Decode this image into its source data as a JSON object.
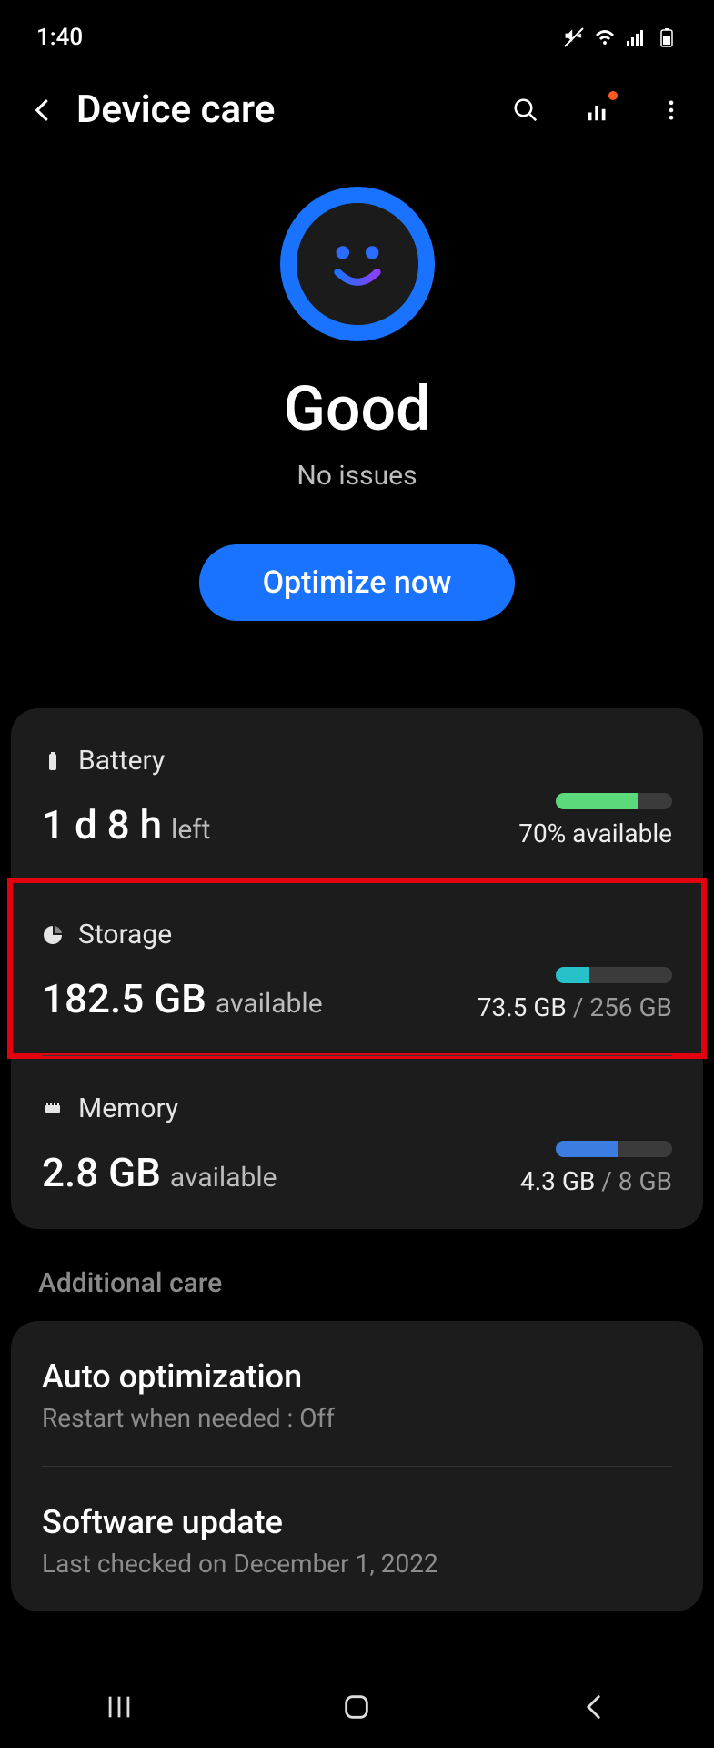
{
  "statusbar": {
    "time": "1:40"
  },
  "header": {
    "title": "Device care"
  },
  "status": {
    "big": "Good",
    "sub": "No issues",
    "optimize_label": "Optimize now"
  },
  "battery": {
    "label": "Battery",
    "value": "1 d 8 h",
    "value_suffix": "left",
    "side_text": "70% available",
    "bar_percent": 70,
    "bar_color": "#5cd97a"
  },
  "storage": {
    "label": "Storage",
    "value": "182.5 GB",
    "value_suffix": "available",
    "used": "73.5 GB",
    "total": "256 GB",
    "bar_percent": 29,
    "bar_color": "#27c2c9"
  },
  "memory": {
    "label": "Memory",
    "value": "2.8 GB",
    "value_suffix": "available",
    "used": "4.3 GB",
    "total": "8 GB",
    "bar_percent": 54,
    "bar_color": "#3b7de0"
  },
  "additional": {
    "section": "Additional care",
    "auto_opt_title": "Auto optimization",
    "auto_opt_sub": "Restart when needed : Off",
    "sw_title": "Software update",
    "sw_sub": "Last checked on December 1, 2022"
  }
}
